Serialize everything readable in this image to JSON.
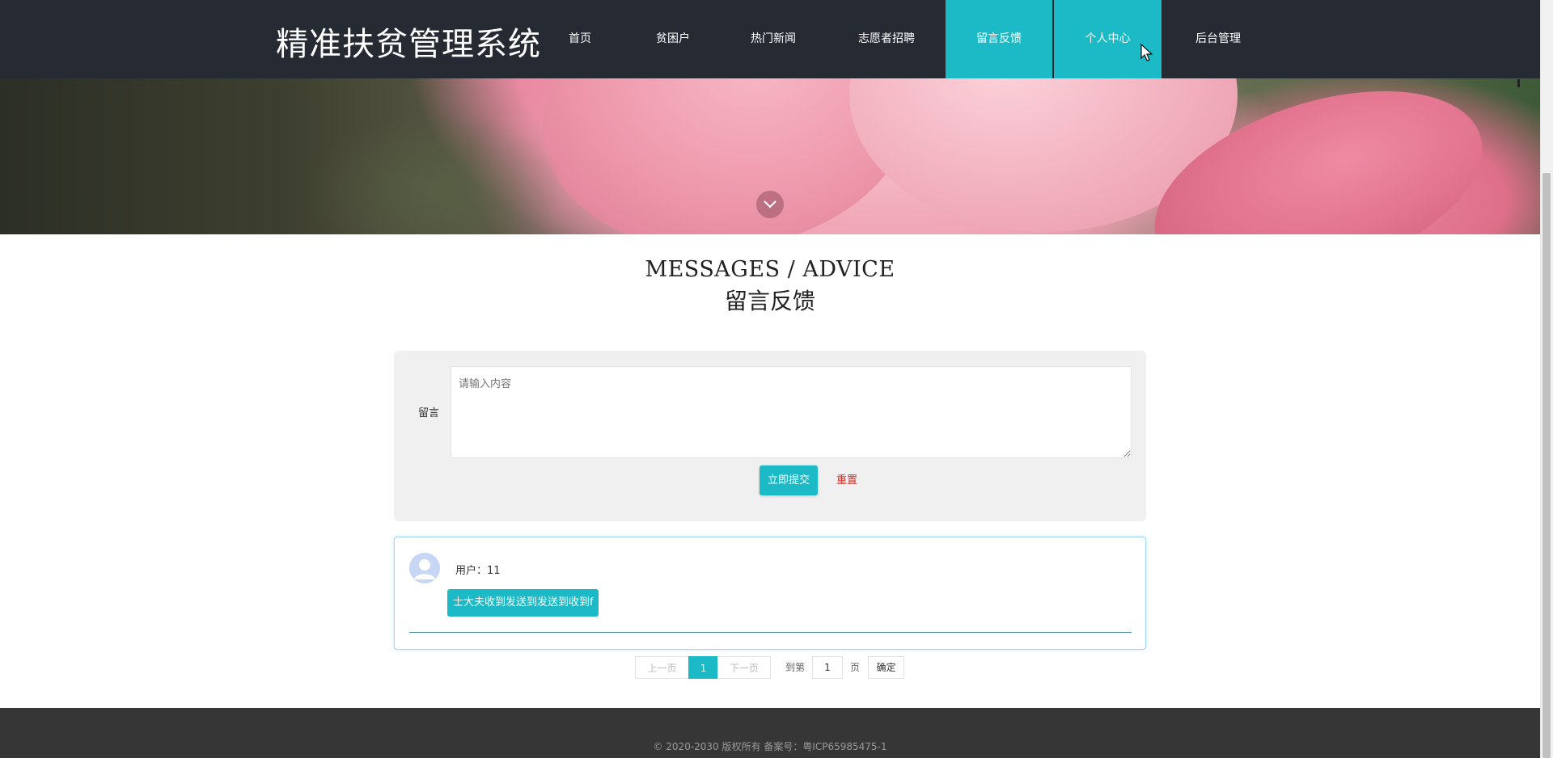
{
  "brand": {
    "title": "精准扶贫管理系统"
  },
  "nav": {
    "items": [
      {
        "label": "首页",
        "active": false
      },
      {
        "label": "贫困户",
        "active": false
      },
      {
        "label": "热门新闻",
        "active": false
      },
      {
        "label": "志愿者招聘",
        "active": false
      },
      {
        "label": "留言反馈",
        "active": true
      },
      {
        "label": "个人中心",
        "active": true
      },
      {
        "label": "后台管理",
        "active": false
      }
    ]
  },
  "heading": {
    "en": "MESSAGES / ADVICE",
    "cn": "留言反馈"
  },
  "form": {
    "label": "留言",
    "placeholder": "请输入内容",
    "value": "",
    "submit_label": "立即提交",
    "reset_label": "重置"
  },
  "messages": [
    {
      "user": "用户：11",
      "content": "士大夫收到发送到发送到收到f"
    }
  ],
  "pagination": {
    "prev_label": "上一页",
    "current_page": "1",
    "next_label": "下一页",
    "goto_prefix": "到第",
    "goto_value": "1",
    "goto_suffix": "页",
    "confirm_label": "确定"
  },
  "footer": {
    "text": "© 2020-2030 版权所有 备案号：粤ICP65985475-1"
  },
  "colors": {
    "accent": "#1bbac6",
    "nav_bg": "#262a33",
    "reset_red": "#c9302c",
    "footer_bg": "#363636"
  },
  "icons": {
    "scroll_down": "chevron-down-icon",
    "avatar": "user-avatar-icon"
  }
}
